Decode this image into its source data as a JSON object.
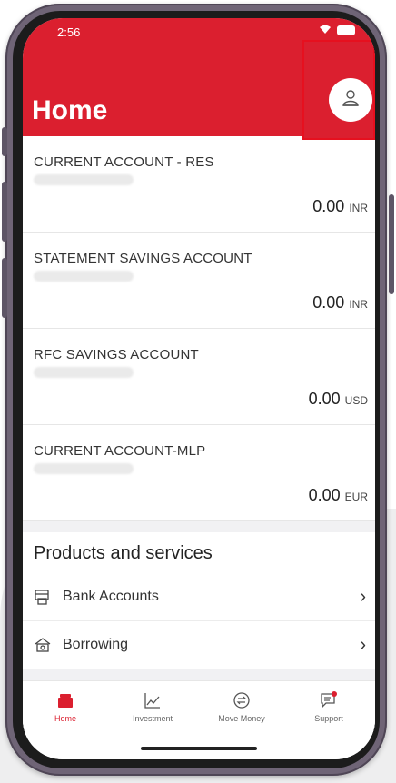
{
  "status_bar": {
    "time": "2:56"
  },
  "header": {
    "title": "Home"
  },
  "accounts": [
    {
      "name": "CURRENT ACCOUNT - RES",
      "amount": "0.00",
      "currency": "INR"
    },
    {
      "name": "STATEMENT SAVINGS ACCOUNT",
      "amount": "0.00",
      "currency": "INR"
    },
    {
      "name": "RFC SAVINGS ACCOUNT",
      "amount": "0.00",
      "currency": "USD"
    },
    {
      "name": "CURRENT ACCOUNT-MLP",
      "amount": "0.00",
      "currency": "EUR"
    }
  ],
  "products": {
    "title": "Products and services",
    "items": [
      {
        "label": "Bank Accounts",
        "icon": "bank-accounts-icon"
      },
      {
        "label": "Borrowing",
        "icon": "borrowing-icon"
      }
    ]
  },
  "tabs": [
    {
      "label": "Home",
      "icon": "home-icon",
      "active": true
    },
    {
      "label": "Investment",
      "icon": "investment-icon",
      "active": false
    },
    {
      "label": "Move Money",
      "icon": "move-money-icon",
      "active": false
    },
    {
      "label": "Support",
      "icon": "support-icon",
      "active": false
    }
  ],
  "colors": {
    "brand_red": "#db1f2f",
    "highlight_border": "#e6101f"
  }
}
